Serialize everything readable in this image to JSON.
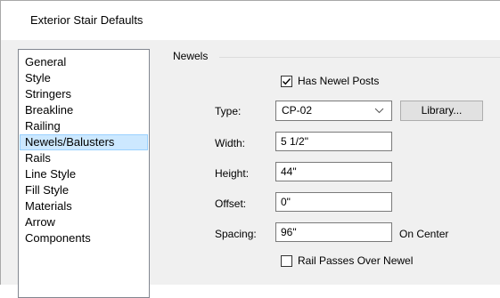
{
  "window": {
    "title": "Exterior Stair Defaults"
  },
  "nav": {
    "items": [
      {
        "label": "General",
        "selected": false
      },
      {
        "label": "Style",
        "selected": false
      },
      {
        "label": "Stringers",
        "selected": false
      },
      {
        "label": "Breakline",
        "selected": false
      },
      {
        "label": "Railing",
        "selected": false
      },
      {
        "label": "Newels/Balusters",
        "selected": true
      },
      {
        "label": "Rails",
        "selected": false
      },
      {
        "label": "Line Style",
        "selected": false
      },
      {
        "label": "Fill Style",
        "selected": false
      },
      {
        "label": "Materials",
        "selected": false
      },
      {
        "label": "Arrow",
        "selected": false
      },
      {
        "label": "Components",
        "selected": false
      }
    ]
  },
  "newels": {
    "group_label": "Newels",
    "has_newel_posts": {
      "label": "Has Newel Posts",
      "checked": true
    },
    "type": {
      "label": "Type:",
      "value": "CP-02",
      "library_button": "Library..."
    },
    "width": {
      "label": "Width:",
      "value": "5 1/2\""
    },
    "height": {
      "label": "Height:",
      "value": "44\""
    },
    "offset": {
      "label": "Offset:",
      "value": "0\""
    },
    "spacing": {
      "label": "Spacing:",
      "value": "96\"",
      "suffix": "On Center"
    },
    "rail_passes_over_newel": {
      "label": "Rail Passes Over Newel",
      "checked": false
    }
  }
}
